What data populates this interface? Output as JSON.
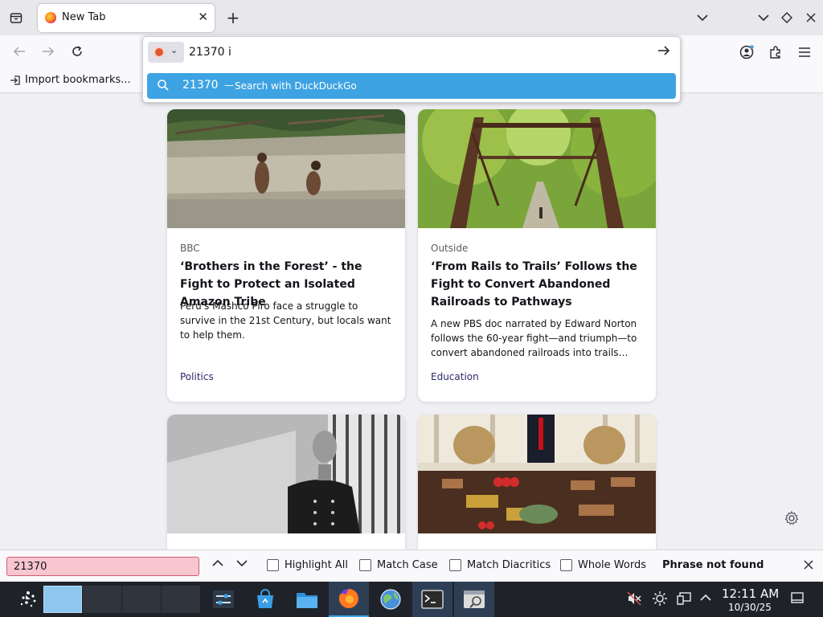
{
  "browser": {
    "tab_title": "New Tab",
    "new_tab_label": "+",
    "bookmark_import_label": "Import bookmarks..."
  },
  "urlbar": {
    "value": "21370 i",
    "suggestion_query": "21370",
    "suggestion_separator": "—",
    "suggestion_hint": "Search with DuckDuckGo"
  },
  "cards": [
    {
      "source": "BBC",
      "headline": "‘Brothers in the Forest’ - the Fight to Protect an Isolated Amazon Tribe",
      "excerpt": "Peru's Mashco Piro face a struggle to survive in the 21st Century, but locals want to help them.",
      "category": "Politics"
    },
    {
      "source": "Outside",
      "headline": "‘From Rails to Trails’ Follows the Fight to Convert Abandoned Railroads to Pathways",
      "excerpt": "A new PBS doc narrated by Edward Norton follows the 60-year fight—and triumph—to convert abandoned railroads into trails…",
      "category": "Education"
    }
  ],
  "findbar": {
    "query": "21370",
    "highlight_all": "Highlight All",
    "match_case": "Match Case",
    "match_diacritics": "Match Diacritics",
    "whole_words": "Whole Words",
    "status": "Phrase not found"
  },
  "taskbar": {
    "time": "12:11 AM",
    "date": "10/30/25"
  },
  "colors": {
    "accent": "#3ea3e2",
    "find_error_bg": "#f7c6cf",
    "taskbar_bg": "#1f2329"
  }
}
